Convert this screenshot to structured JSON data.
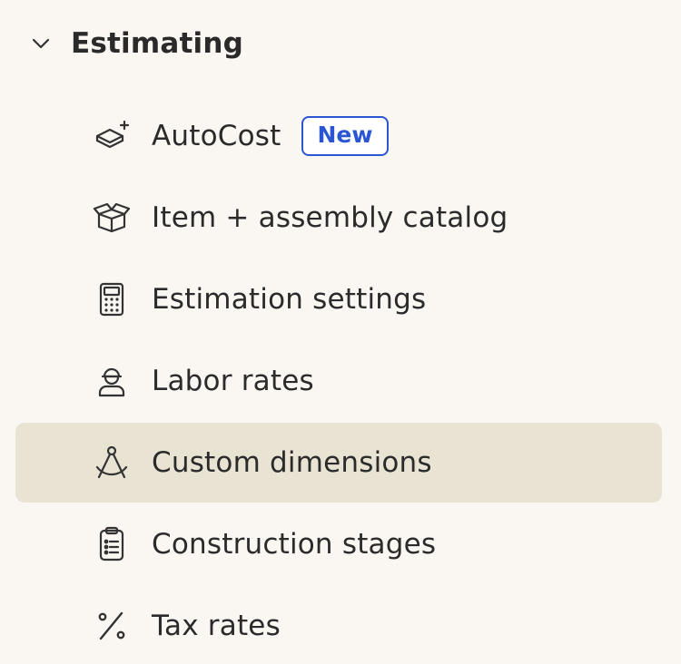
{
  "section": {
    "title": "Estimating",
    "expand_icon": "chevron-down-icon"
  },
  "items": [
    {
      "label": "AutoCost",
      "icon": "layers-sparkle-icon",
      "badge": "New"
    },
    {
      "label": "Item + assembly catalog",
      "icon": "open-box-icon"
    },
    {
      "label": "Estimation settings",
      "icon": "calculator-icon"
    },
    {
      "label": "Labor rates",
      "icon": "worker-icon"
    },
    {
      "label": "Custom dimensions",
      "icon": "compass-dimension-icon",
      "active": true
    },
    {
      "label": "Construction stages",
      "icon": "clipboard-list-icon"
    },
    {
      "label": "Tax rates",
      "icon": "percent-icon"
    }
  ],
  "colors": {
    "background": "#faf7f3",
    "active_background": "#e9e3d4",
    "badge": "#2a56d1",
    "text": "#2b2b2b"
  }
}
